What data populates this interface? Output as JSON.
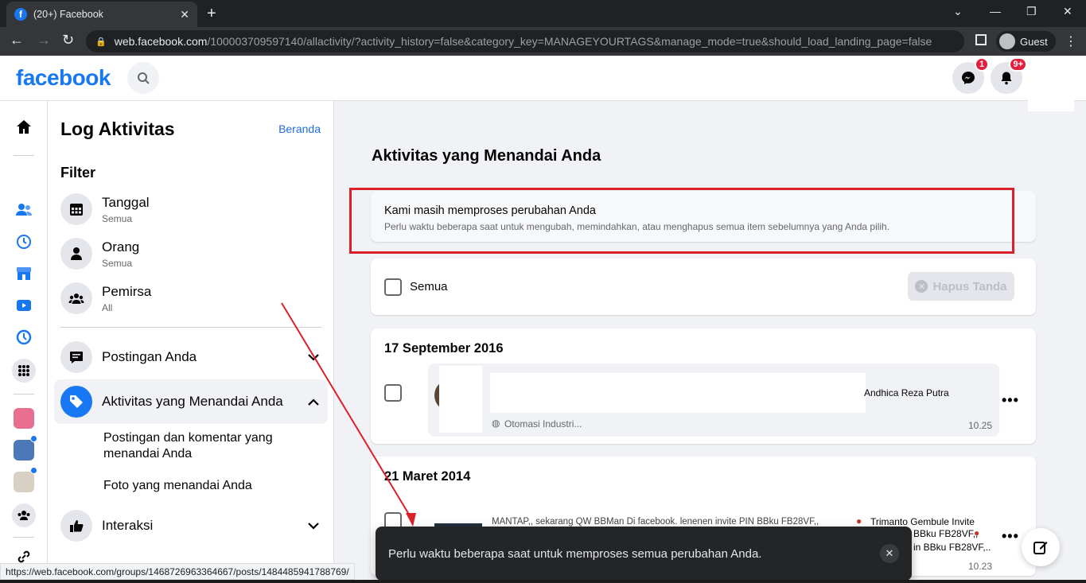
{
  "browser": {
    "tab_title": "(20+) Facebook",
    "url_host": "web.facebook.com",
    "url_path": "/100003709597140/allactivity/?activity_history=false&category_key=MANAGEYOURTAGS&manage_mode=true&should_load_landing_page=false",
    "profile_label": "Guest",
    "status_url": "https://web.facebook.com/groups/1468726963364667/posts/1484485941788769/"
  },
  "header": {
    "logo": "facebook",
    "messenger_badge": "1",
    "notifications_badge": "9+"
  },
  "sidebar": {
    "title": "Log Aktivitas",
    "home_link": "Beranda",
    "filter_heading": "Filter",
    "filters": [
      {
        "label": "Tanggal",
        "value": "Semua",
        "icon": "calendar-icon"
      },
      {
        "label": "Orang",
        "value": "Semua",
        "icon": "person-icon"
      },
      {
        "label": "Pemirsa",
        "value": "All",
        "icon": "group-icon"
      }
    ],
    "nav": [
      {
        "label": "Postingan Anda",
        "icon": "post-icon"
      },
      {
        "label": "Aktivitas yang Menandai Anda",
        "icon": "tag-icon"
      },
      {
        "label": "Interaksi",
        "icon": "like-icon"
      }
    ],
    "subitems": [
      "Postingan dan komentar yang menandai Anda",
      "Foto yang menandai Anda"
    ]
  },
  "main": {
    "title": "Aktivitas yang Menandai Anda",
    "notice_title": "Kami masih memproses perubahan Anda",
    "notice_desc": "Perlu waktu beberapa saat untuk mengubah, memindahkan, atau menghapus semua item sebelumnya yang Anda pilih.",
    "select_all_label": "Semua",
    "remove_tag_button": "Hapus Tanda",
    "groups": [
      {
        "date": "17 September 2016",
        "post_author": "Andhica Reza Putra",
        "post_source": "Otomasi Industri...",
        "time": "10.25"
      },
      {
        "date": "21 Maret 2014",
        "line1": "MANTAP,, sekarang QW BBMan Di facebook. lenenen invite PIN BBku FB28VF,,",
        "line1_name": "Trimanto Gembule Invite",
        "line2": "BBku FB28VF,,",
        "line3": "in BBku FB28VF,..",
        "time": "10.23"
      }
    ]
  },
  "toast": {
    "text": "Perlu waktu beberapa saat untuk memproses semua perubahan Anda."
  },
  "colors": {
    "brand": "#1877f2",
    "annotation_red": "#d9202b",
    "badge_red": "#e41e3f"
  }
}
